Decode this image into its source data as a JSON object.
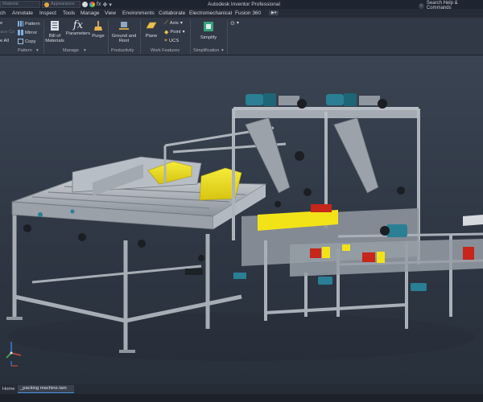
{
  "titlebar": {
    "material_field": "Material",
    "appearance_field": "Appearance",
    "fx_label": "fx",
    "app_title": "Autodesk Inventor Professional",
    "help_search": "Search Help & Commands"
  },
  "tabs": [
    {
      "label": "ch"
    },
    {
      "label": "Annotate"
    },
    {
      "label": "Inspect"
    },
    {
      "label": "Tools"
    },
    {
      "label": "Manage"
    },
    {
      "label": "View"
    },
    {
      "label": "Environments"
    },
    {
      "label": "Collaborate"
    },
    {
      "label": "Electromechanical"
    },
    {
      "label": "Fusion 360"
    }
  ],
  "ribbon": {
    "pattern_panel": {
      "items": [
        "Pattern",
        "Mirror",
        "Copy"
      ],
      "left_fragments": [
        "e",
        "ace Co",
        "e All"
      ],
      "label": "Pattern"
    },
    "manage_panel": {
      "bom": "Bill of\nMaterials",
      "parameters": "Parameters",
      "purge": "Purge",
      "label": "Manage"
    },
    "productivity_panel": {
      "ground_root": "Ground and\nRoot",
      "label": "Productivity"
    },
    "work_features_panel": {
      "plane": "Plane",
      "axis": "Axis",
      "point": "Point",
      "ucs": "UCS",
      "label": "Work Features"
    },
    "simplification_panel": {
      "simplify": "Simplify",
      "label": "Simplification"
    }
  },
  "viewport": {
    "background_top": "#3a4452",
    "background_bottom": "#28303b",
    "frame_color": "#a9afb7",
    "guard_yellow": "#f2e318",
    "motor_teal": "#2a7f94",
    "accent_red": "#c7261b"
  },
  "document_tabs": {
    "home": "Home",
    "active_document": "_packing machine.iam"
  }
}
